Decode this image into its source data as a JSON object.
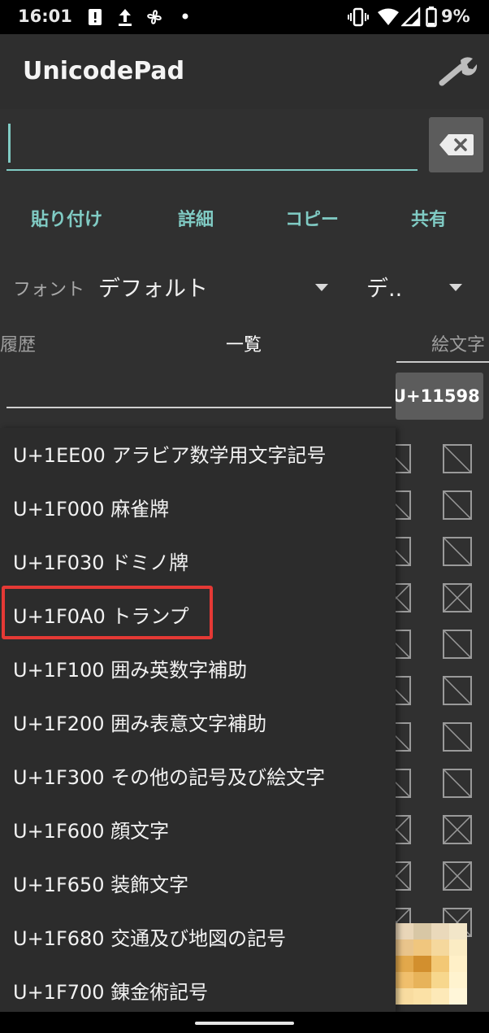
{
  "status_bar": {
    "time": "16:01",
    "battery": "9%",
    "left_icons": [
      "alert-icon",
      "upload-icon",
      "pinwheel-icon",
      "dot-icon"
    ],
    "right_icons": [
      "vibrate-icon",
      "wifi-icon",
      "signal-icon",
      "battery-icon"
    ]
  },
  "app_bar": {
    "title": "UnicodePad",
    "settings_icon": "wrench-icon"
  },
  "input": {
    "value": "",
    "placeholder": ""
  },
  "actions": [
    "貼り付け",
    "詳細",
    "コピー",
    "共有"
  ],
  "font_row": {
    "label": "フォント",
    "value": "デフォルト",
    "second_value": "デ.."
  },
  "tabs": [
    "履歴",
    "一覧",
    "絵文字"
  ],
  "code_button": "U+11598",
  "dropdown": {
    "items": [
      "U+1EE00 アラビア数学用文字記号",
      "U+1F000 麻雀牌",
      "U+1F030 ドミノ牌",
      "U+1F0A0 トランプ",
      "U+1F100 囲み英数字補助",
      "U+1F200 囲み表意文字補助",
      "U+1F300 その他の記号及び絵文字",
      "U+1F600 顔文字",
      "U+1F650 装飾文字",
      "U+1F680 交通及び地図の記号",
      "U+1F700 錬金術記号"
    ],
    "highlighted_index": 3,
    "highlight_color": "#e53935"
  },
  "colors": {
    "accent": "#80cbc4",
    "background": "#303030",
    "button": "#5c5c5c"
  }
}
